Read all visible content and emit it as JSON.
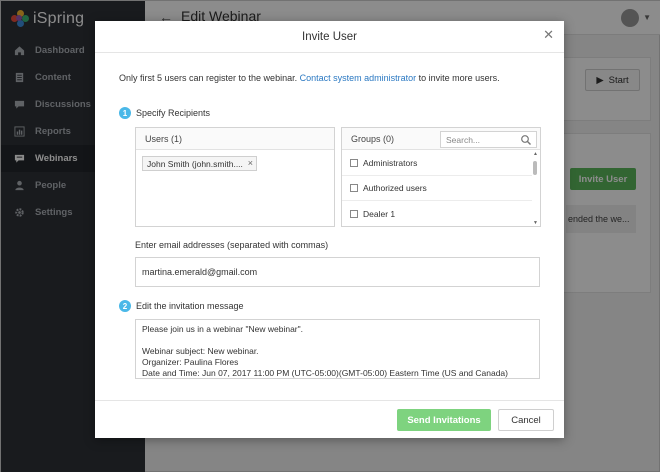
{
  "app": {
    "brand": "iSpring",
    "page_title": "Edit Webinar",
    "sidebar": [
      {
        "label": "Dashboard",
        "icon": "home-icon"
      },
      {
        "label": "Content",
        "icon": "content-icon"
      },
      {
        "label": "Discussions",
        "icon": "discussions-icon"
      },
      {
        "label": "Reports",
        "icon": "reports-icon"
      },
      {
        "label": "Webinars",
        "icon": "webinars-icon",
        "active": true
      },
      {
        "label": "People",
        "icon": "people-icon"
      },
      {
        "label": "Settings",
        "icon": "settings-icon"
      }
    ],
    "background": {
      "start_label": "Start",
      "invite_user_label": "Invite User",
      "note_text": "ended the we..."
    }
  },
  "modal": {
    "title": "Invite User",
    "notice_prefix": "Only first 5 users can register to the webinar. ",
    "notice_link": "Contact system administrator",
    "notice_suffix": " to invite more users.",
    "step1": {
      "number": "1",
      "label": "Specify Recipients"
    },
    "users": {
      "header": "Users (1)",
      "chips": [
        "John Smith (john.smith...."
      ]
    },
    "groups": {
      "header": "Groups (0)",
      "search_placeholder": "Search...",
      "items": [
        "Administrators",
        "Authorized users",
        "Dealer 1"
      ]
    },
    "email": {
      "label": "Enter email addresses (separated with commas)",
      "value": "martina.emerald@gmail.com"
    },
    "step2": {
      "number": "2",
      "label": "Edit the invitation message"
    },
    "message_lines": [
      "Please join us in a webinar \"New webinar\".",
      "",
      "Webinar subject: New webinar.",
      "Organizer: Paulina Flores",
      "Date and Time: Jun 07, 2017 11:00 PM (UTC-05:00)(GMT-05:00) Eastern Time (US and Canada)"
    ],
    "send_label": "Send Invitations",
    "cancel_label": "Cancel"
  },
  "colors": {
    "sidebar": "#2f3238",
    "accent_link": "#2a78c2",
    "step_badge": "#4ab8e8",
    "send_button": "#7ed37f",
    "invite_button": "#5cb85c"
  }
}
